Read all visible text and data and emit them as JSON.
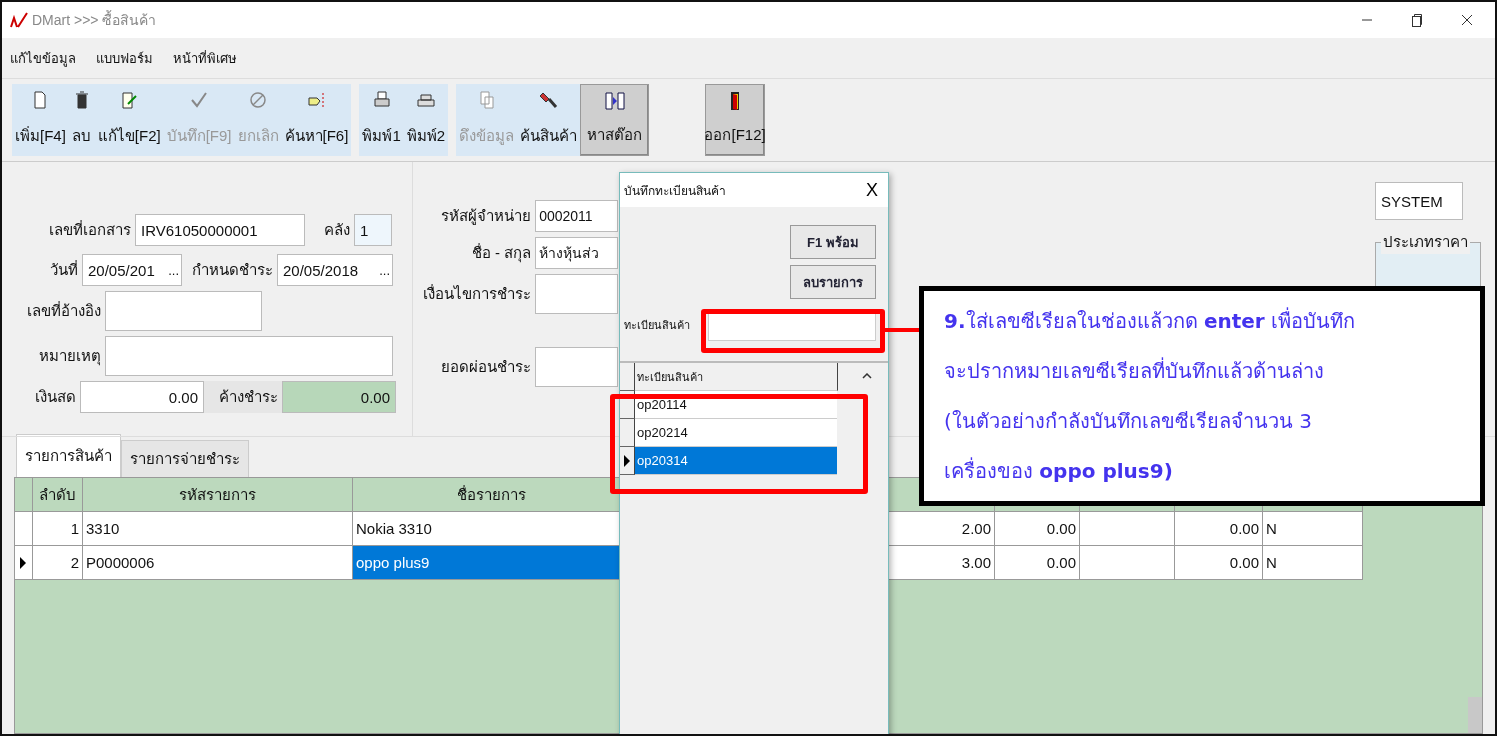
{
  "window": {
    "title": "DMart >>> ซื้อสินค้า"
  },
  "menu": [
    "แก้ไขข้อมูล",
    "แบบฟอร์ม",
    "หน้าที่พิเศษ"
  ],
  "toolbar": [
    [
      {
        "label": "เพิ่ม[F4]",
        "disabled": false,
        "raised": false
      },
      {
        "label": "ลบ",
        "disabled": false,
        "raised": false
      },
      {
        "label": "แก้ไข[F2]",
        "disabled": false,
        "raised": false
      },
      {
        "label": "บันทึก[F9]",
        "disabled": true,
        "raised": false
      },
      {
        "label": "ยกเลิก",
        "disabled": true,
        "raised": false
      },
      {
        "label": "ค้นหา[F6]",
        "disabled": false,
        "raised": false
      }
    ],
    [
      {
        "label": "พิมพ์1",
        "disabled": false,
        "raised": false
      },
      {
        "label": "พิมพ์2",
        "disabled": false,
        "raised": false
      }
    ],
    [
      {
        "label": "ดึงข้อมูล",
        "disabled": true,
        "raised": false
      },
      {
        "label": "ค้นสินค้า",
        "disabled": false,
        "raised": false
      },
      {
        "label": "หาสต๊อก",
        "disabled": false,
        "raised": true
      }
    ],
    [
      {
        "label": "ออก[F12]",
        "disabled": false,
        "raised": true
      }
    ]
  ],
  "form": {
    "document_no": {
      "label": "เลขที่เอกสาร",
      "value": "IRV61050000001"
    },
    "warehouse": {
      "label": "คลัง",
      "value": "1"
    },
    "date": {
      "label": "วันที่",
      "value": "20/05/201",
      "button": "..."
    },
    "due_date": {
      "label": "กำหนดชำระ",
      "value": "20/05/2018",
      "button": "..."
    },
    "reference_no": {
      "label": "เลขที่อ้างอิง"
    },
    "note": {
      "label": "หมายเหตุ"
    },
    "cash": {
      "label": "เงินสด",
      "value": "0.00"
    },
    "outstanding": {
      "label": "ค้างชำระ",
      "value": "0.00"
    },
    "supplier_code": {
      "label": "รหัสผู้จำหน่าย",
      "value": "0002011"
    },
    "name": {
      "label": "ชื่อ - สกุล",
      "value": "ห้างหุ้นส่ว"
    },
    "payment_terms": {
      "label": "เงื่อนไขการชำระ"
    },
    "installment": {
      "label": "ยอดผ่อนชำระ"
    },
    "user": {
      "value": "SYSTEM"
    },
    "price_type": {
      "label": "ประเภทราคา"
    }
  },
  "tabs": [
    {
      "label": "รายการสินค้า",
      "selected": true
    },
    {
      "label": "รายการจ่ายชำระ",
      "selected": false
    }
  ],
  "table": {
    "columns": [
      "ลำดับ",
      "รหัสรายการ",
      "ชื่อรายการ"
    ],
    "rows": [
      {
        "selected": false,
        "cells": [
          "1",
          "3310",
          "Nokia 3310"
        ],
        "column_4": "2.00",
        "column_5": "0.00",
        "column_7": "0.00",
        "column_8": "N"
      },
      {
        "selected": true,
        "cells": [
          "2",
          "P0000006",
          "oppo plus9"
        ],
        "column_4": "3.00",
        "column_5": "0.00",
        "column_7": "0.00",
        "column_8": "N"
      }
    ]
  },
  "dialog": {
    "title": "บันทึกทะเบียนสินค้า",
    "close": "X",
    "buttons": [
      "F1 พร้อม",
      "ลบรายการ"
    ],
    "field": {
      "label": "ทะเบียนสินค้า"
    },
    "list": {
      "column": "ทะเบียนสินค้า",
      "rows": [
        {
          "value": "op20114",
          "selected": false
        },
        {
          "value": "op20214",
          "selected": false
        },
        {
          "value": "op20314",
          "selected": true
        }
      ]
    }
  },
  "callout": {
    "lines": [
      "**9.**ใส่เลขซีเรียลในช่องแล้วกด **enter** เพื่อบันทึก",
      "จะปรากหมายเลขซีเรียลที่บันทึกแล้วด้านล่าง",
      "(ในตัวอย่างกำลังบันทึกเลขซีเรียลจำนวน 3",
      "เครื่องของ **oppo plus9)**"
    ]
  }
}
